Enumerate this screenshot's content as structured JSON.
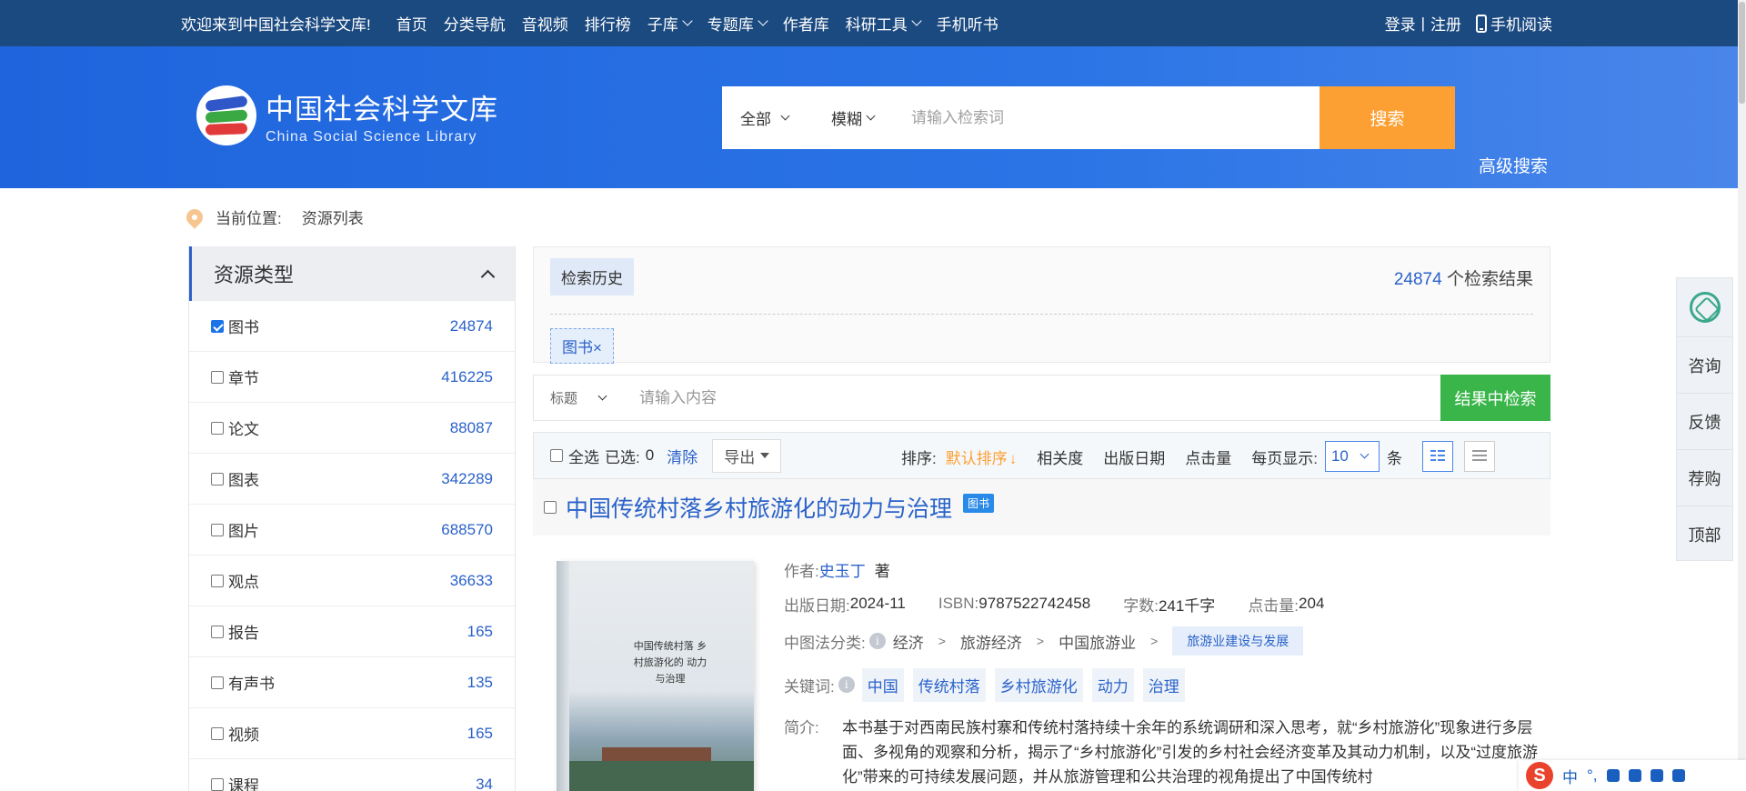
{
  "topbar": {
    "welcome": "欢迎来到中国社会科学文库!",
    "nav": [
      {
        "label": "首页",
        "dropdown": false
      },
      {
        "label": "分类导航",
        "dropdown": false
      },
      {
        "label": "音视频",
        "dropdown": false
      },
      {
        "label": "排行榜",
        "dropdown": false
      },
      {
        "label": "子库",
        "dropdown": true
      },
      {
        "label": "专题库",
        "dropdown": true
      },
      {
        "label": "作者库",
        "dropdown": false
      },
      {
        "label": "科研工具",
        "dropdown": true
      },
      {
        "label": "手机听书",
        "dropdown": false
      }
    ],
    "login": "登录",
    "sep": "|",
    "register": "注册",
    "mobile": "手机阅读"
  },
  "header": {
    "logo_cn": "中国社会科学文库",
    "logo_en": "China Social Science Library",
    "search_scope": "全部",
    "search_mode": "模糊",
    "search_placeholder": "请输入检索词",
    "search_button": "搜索",
    "advanced": "高级搜索"
  },
  "breadcrumb": {
    "label": "当前位置:",
    "current": "资源列表"
  },
  "sidebar": {
    "title": "资源类型",
    "items": [
      {
        "label": "图书",
        "count": "24874",
        "checked": true
      },
      {
        "label": "章节",
        "count": "416225",
        "checked": false
      },
      {
        "label": "论文",
        "count": "88087",
        "checked": false
      },
      {
        "label": "图表",
        "count": "342289",
        "checked": false
      },
      {
        "label": "图片",
        "count": "688570",
        "checked": false
      },
      {
        "label": "观点",
        "count": "36633",
        "checked": false
      },
      {
        "label": "报告",
        "count": "165",
        "checked": false
      },
      {
        "label": "有声书",
        "count": "135",
        "checked": false
      },
      {
        "label": "视频",
        "count": "165",
        "checked": false
      },
      {
        "label": "课程",
        "count": "34",
        "checked": false
      }
    ]
  },
  "history": {
    "label": "检索历史",
    "count": "24874",
    "count_suffix": "个检索结果",
    "chip": "图书",
    "chip_close": "×"
  },
  "filter": {
    "field": "标题",
    "placeholder": "请输入内容",
    "button": "结果中检索"
  },
  "toolbar": {
    "select_all": "全选",
    "selected_label": "已选:",
    "selected_count": "0",
    "clear": "清除",
    "export": "导出",
    "sort_label": "排序:",
    "sort_default": "默认排序",
    "sort_relevance": "相关度",
    "sort_date": "出版日期",
    "sort_clicks": "点击量",
    "per_page_label": "每页显示:",
    "per_page": "10",
    "per_page_unit": "条"
  },
  "result": {
    "title": "中国传统村落乡村旅游化的动力与治理",
    "badge": "图书",
    "cover_text": "中国传统村落 乡村旅游化的 动力与治理",
    "author_label": "作者:",
    "author": "史玉丁",
    "author_role": "著",
    "date_label": "出版日期:",
    "date": "2024-11",
    "isbn_label": "ISBN:",
    "isbn": "9787522742458",
    "words_label": "字数:",
    "words": "241千字",
    "clicks_label": "点击量:",
    "clicks": "204",
    "class_label": "中图法分类:",
    "class_path": [
      "经济",
      "旅游经济",
      "中国旅游业"
    ],
    "class_arrow": ">",
    "class_leaf": "旅游业建设与发展",
    "kw_label": "关键词:",
    "keywords": [
      "中国",
      "传统村落",
      "乡村旅游化",
      "动力",
      "治理"
    ],
    "desc_label": "简介:",
    "desc": "本书基于对西南民族村寨和传统村落持续十余年的系统调研和深入思考，就“乡村旅游化”现象进行多层面、多视角的观察和分析，揭示了“乡村旅游化”引发的乡村社会经济变革及其动力机制，以及“过度旅游化”带来的可持续发展问题，并从旅游管理和公共治理的视角提出了中国传统村"
  },
  "float": {
    "items": [
      "咨询",
      "反馈",
      "荐购",
      "顶部"
    ]
  },
  "ime": {
    "lang": "中",
    "punct": "°,"
  }
}
